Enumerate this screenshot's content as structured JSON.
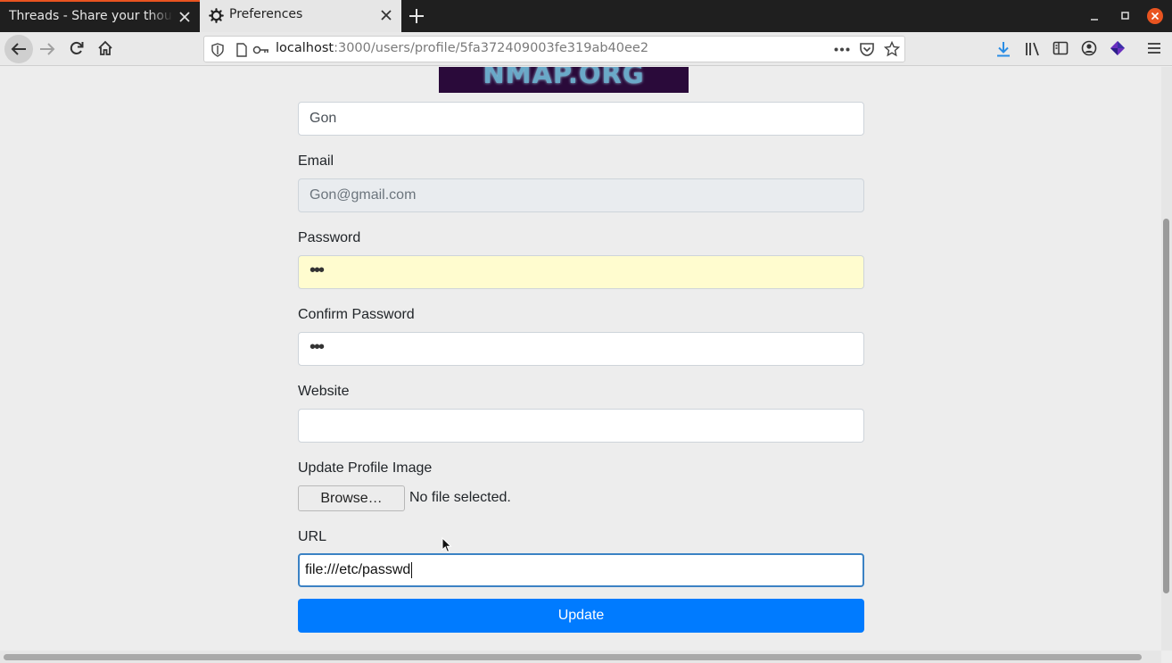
{
  "browser": {
    "tabs": [
      {
        "title": "Threads - Share your thoughts",
        "active": false
      },
      {
        "title": "Preferences",
        "active": true,
        "icon": "gear-icon"
      }
    ],
    "url": {
      "host": "localhost",
      "path": ":3000/users/profile/5fa372409003fe319ab40ee2"
    }
  },
  "page": {
    "banner_text": "NMAP.ORG",
    "form": {
      "name_value": "Gon",
      "email_label": "Email",
      "email_value": "Gon@gmail.com",
      "password_label": "Password",
      "password_value": "•••",
      "confirm_label": "Confirm Password",
      "confirm_value": "•••",
      "website_label": "Website",
      "website_value": "",
      "image_label": "Update Profile Image",
      "browse_label": "Browse…",
      "no_file_text": "No file selected.",
      "url_label": "URL",
      "url_value": "file:///etc/passwd",
      "submit_label": "Update"
    }
  },
  "colors": {
    "primary": "#007bff",
    "autofill": "#fffccf",
    "accent_tab": "#e95420",
    "close_red": "#e95420"
  }
}
